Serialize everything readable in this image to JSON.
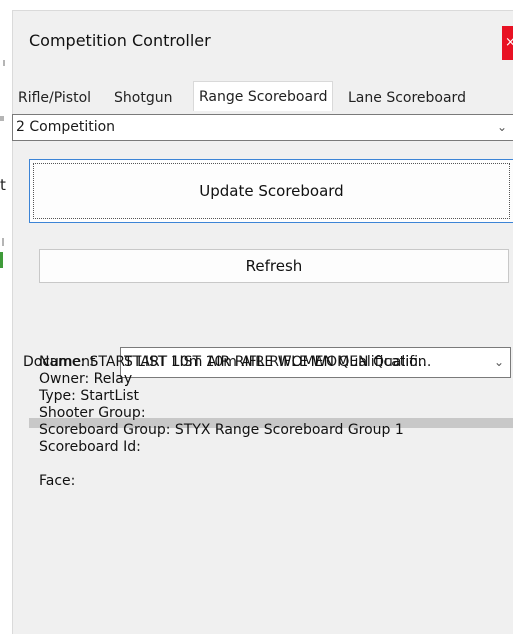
{
  "window": {
    "title": "Competition Controller",
    "close_glyph": "×"
  },
  "tabs": [
    {
      "label": "Rifle/Pistol"
    },
    {
      "label": "Shotgun"
    },
    {
      "label": "Range Scoreboard",
      "active": true
    },
    {
      "label": "Lane Scoreboard"
    }
  ],
  "competition_select": {
    "value": "2 Competition"
  },
  "buttons": {
    "update": "Update Scoreboard",
    "refresh": "Refresh"
  },
  "document": {
    "label": "Document",
    "value": "START LIST 10m AIR RIFLE WOMEN Qualifi..."
  },
  "info": {
    "name": "Name: START LIST 10m AIR RIFLE WOMEN Qualification",
    "owner": "Owner: Relay",
    "type": "Type: StartList",
    "shooter_group": "Shooter Group:",
    "scoreboard_group": "Scoreboard Group: STYX Range Scoreboard Group 1",
    "scoreboard_id": "Scoreboard Id:",
    "face": "Face:"
  },
  "background": {
    "edge_glyph": "t"
  },
  "colors": {
    "accent": "#3c84d6",
    "close": "#e81123",
    "window_bg": "#f0f0f0"
  }
}
